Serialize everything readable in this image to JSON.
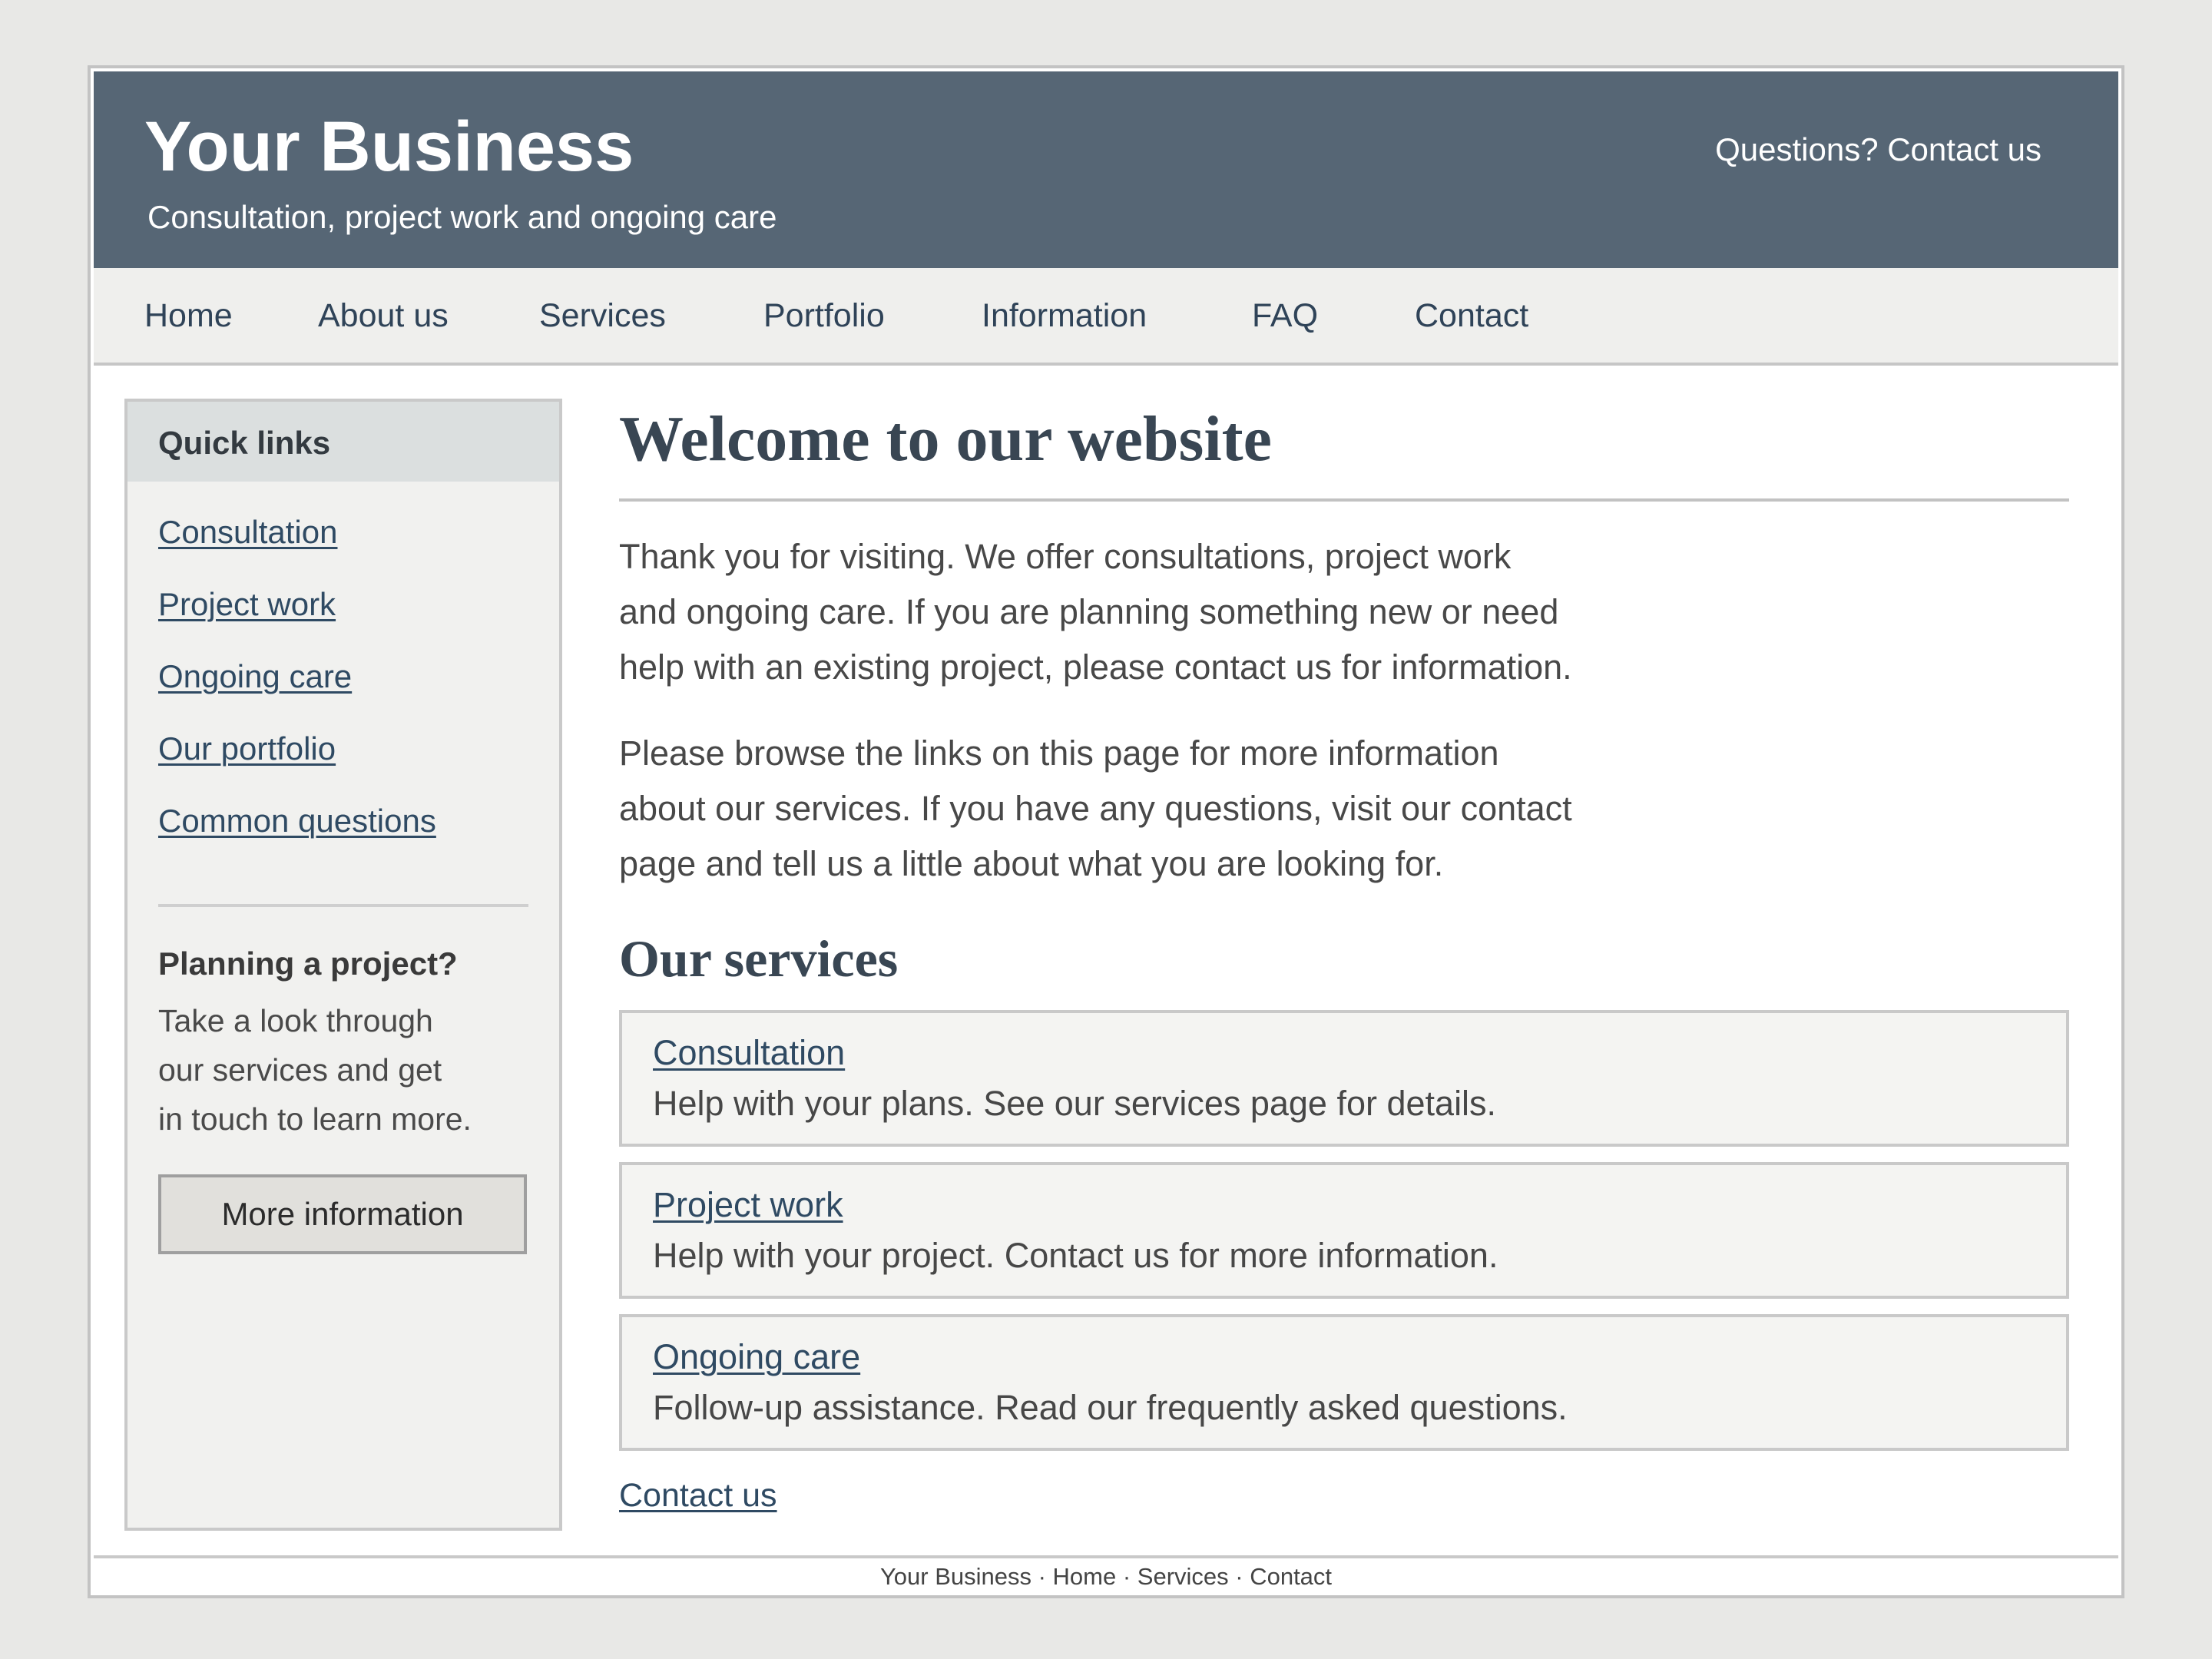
{
  "header": {
    "title": "Your Business",
    "tagline": "Consultation, project work and ongoing care",
    "contact_link": "Questions? Contact us"
  },
  "nav": {
    "items": [
      "Home",
      "About us",
      "Services",
      "Portfolio",
      "Information",
      "FAQ",
      "Contact"
    ]
  },
  "sidebar": {
    "heading": "Quick links",
    "links": [
      "Consultation",
      "Project work",
      "Ongoing care",
      "Our portfolio",
      "Common questions"
    ],
    "plan_title": "Planning a project?",
    "plan_lines": [
      "Take a look through",
      "our services and get",
      "in touch to learn more."
    ],
    "button_label": "More information"
  },
  "main": {
    "heading": "Welcome to our website",
    "paragraph1": [
      "Thank you for visiting. We offer consultations, project work",
      "and ongoing care. If you are planning something new or need",
      "help with an existing project, please contact us for information."
    ],
    "paragraph2": [
      "Please browse the links on this page for more information",
      "about our services. If you have any questions, visit our contact",
      "page and tell us a little about what you are looking for."
    ],
    "services_heading": "Our services",
    "services": [
      {
        "title": "Consultation",
        "description": "Help with your plans. See our services page for details."
      },
      {
        "title": "Project work",
        "description": "Help with your project. Contact us for more information."
      },
      {
        "title": "Ongoing care",
        "description": "Follow-up assistance. Read our frequently asked questions."
      }
    ],
    "contact_link": "Contact us"
  },
  "footer": {
    "text": "Your Business · Home · Services · Contact"
  },
  "colors": {
    "header_bg": "#566675",
    "nav_bg": "#efefed",
    "link": "#2f4a63",
    "heading": "#394653",
    "page_bg": "#e8e8e6"
  }
}
